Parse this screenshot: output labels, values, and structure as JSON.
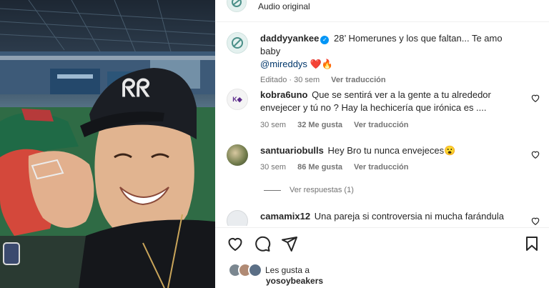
{
  "header": {
    "audio_label": "Audio original"
  },
  "caption": {
    "username": "daddyyankee",
    "verified": true,
    "text_before_mention": "28’ Homerunes y los que faltan... Te amo baby",
    "mention": "@mireddys",
    "emojis": "❤️🔥",
    "meta_edited": "Editado · 30 sem",
    "translate_label": "Ver traducción"
  },
  "comments": [
    {
      "username": "kobra6uno",
      "text": "Que se sentirá ver a la gente a tu alrededor envejecer y tú no ? Hay la hechicería que irónica es ....",
      "time": "30 sem",
      "likes": "32 Me gusta",
      "translate_label": "Ver traducción"
    },
    {
      "username": "santuariobulls",
      "text": "Hey Bro tu nunca envejeces😮",
      "time": "30 sem",
      "likes": "86 Me gusta",
      "translate_label": "Ver traducción",
      "replies_label": "Ver respuestas (1)"
    },
    {
      "username": "camamix12",
      "text": "Una pareja si controversia ni mucha farándula"
    }
  ],
  "footer": {
    "liked_by_prefix": "Les gusta a",
    "liked_by_user": "yosoybeakers"
  },
  "icons": {
    "header_avatar": "profile-avatar-icon",
    "like": "heart-icon",
    "comment": "comment-bubble-icon",
    "share": "paper-plane-icon",
    "save": "bookmark-icon",
    "comment_like": "small-heart-icon"
  },
  "colors": {
    "accent_link": "#00376b",
    "verified": "#0095f6",
    "meta_text": "#737373"
  }
}
